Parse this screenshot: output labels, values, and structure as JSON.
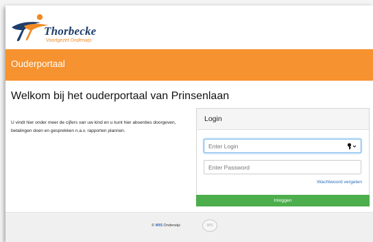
{
  "brand": {
    "name": "Thorbecke",
    "subtitle": "Voortgezet Onderwijs",
    "accent_color": "#f6922f",
    "logo_icon": "thorbecke-logo-icon"
  },
  "band": {
    "title": "Ouderportaal"
  },
  "welcome": {
    "heading": "Welkom bij het ouderportaal van Prinsenlaan",
    "intro": "U vindt hier onder meer de cijfers van uw kind en u kunt hier absenties doorgeven, betalingen doen en gesprekken n.a.v. rapporten plannen."
  },
  "login": {
    "title": "Login",
    "login_placeholder": "Enter Login",
    "login_value": "",
    "password_placeholder": "Enter Password",
    "password_value": "",
    "key_icon": "key-icon",
    "forgot_label": "Wachtwoord vergeten",
    "submit_label": "Inloggen",
    "submit_color": "#4cae4c"
  },
  "footer": {
    "copyright_symbol": "©",
    "brand": "WIS",
    "brand_suffix": "Onderwijs",
    "badge": "WIS"
  }
}
